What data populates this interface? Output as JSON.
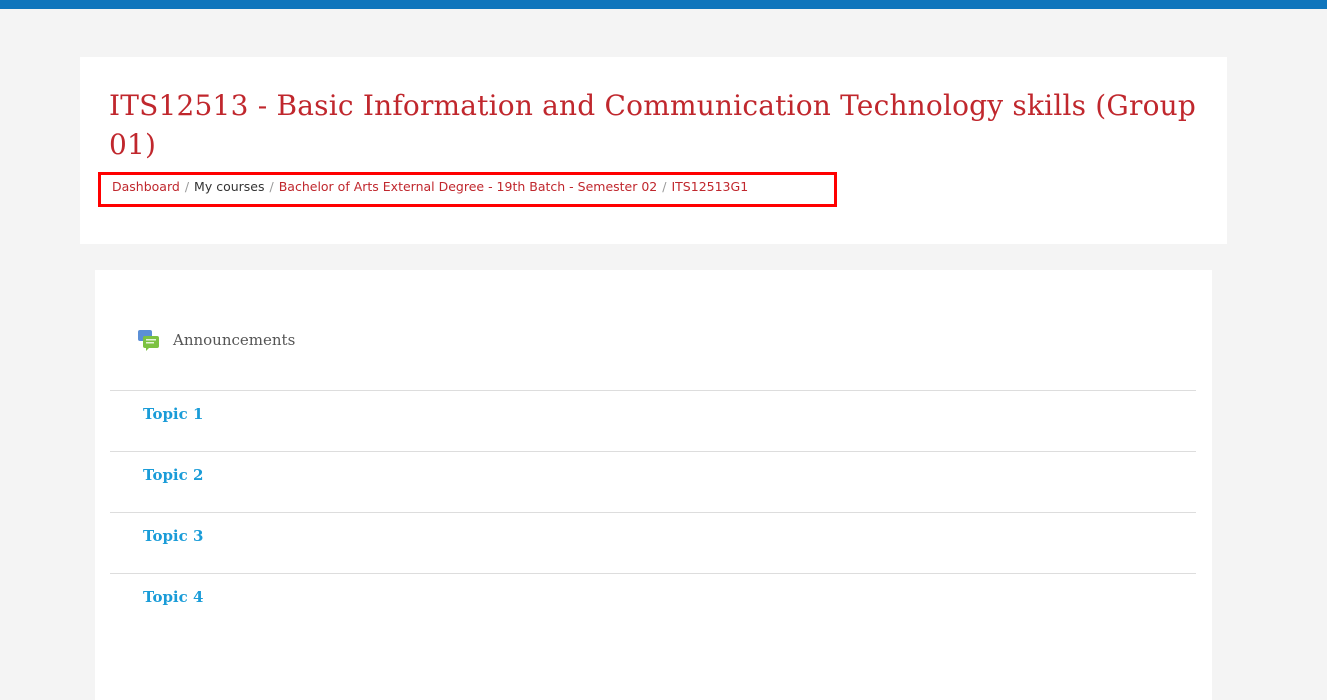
{
  "course": {
    "title": "ITS12513 - Basic Information and Communication Technology skills (Group 01)"
  },
  "breadcrumb": [
    {
      "label": "Dashboard"
    },
    {
      "label": "My courses"
    },
    {
      "label": "Bachelor of Arts External Degree - 19th Batch - Semester 02"
    },
    {
      "label": "ITS12513G1"
    }
  ],
  "breadcrumb_separator": "/",
  "announcements": {
    "label": "Announcements",
    "icon": "forum-icon"
  },
  "topics": [
    {
      "label": "Topic 1"
    },
    {
      "label": "Topic 2"
    },
    {
      "label": "Topic 3"
    },
    {
      "label": "Topic 4"
    }
  ],
  "colors": {
    "accent_bar": "#0f75bc",
    "title": "#c0272d",
    "link": "#1a9cd8",
    "highlight_box": "#ff0000"
  }
}
